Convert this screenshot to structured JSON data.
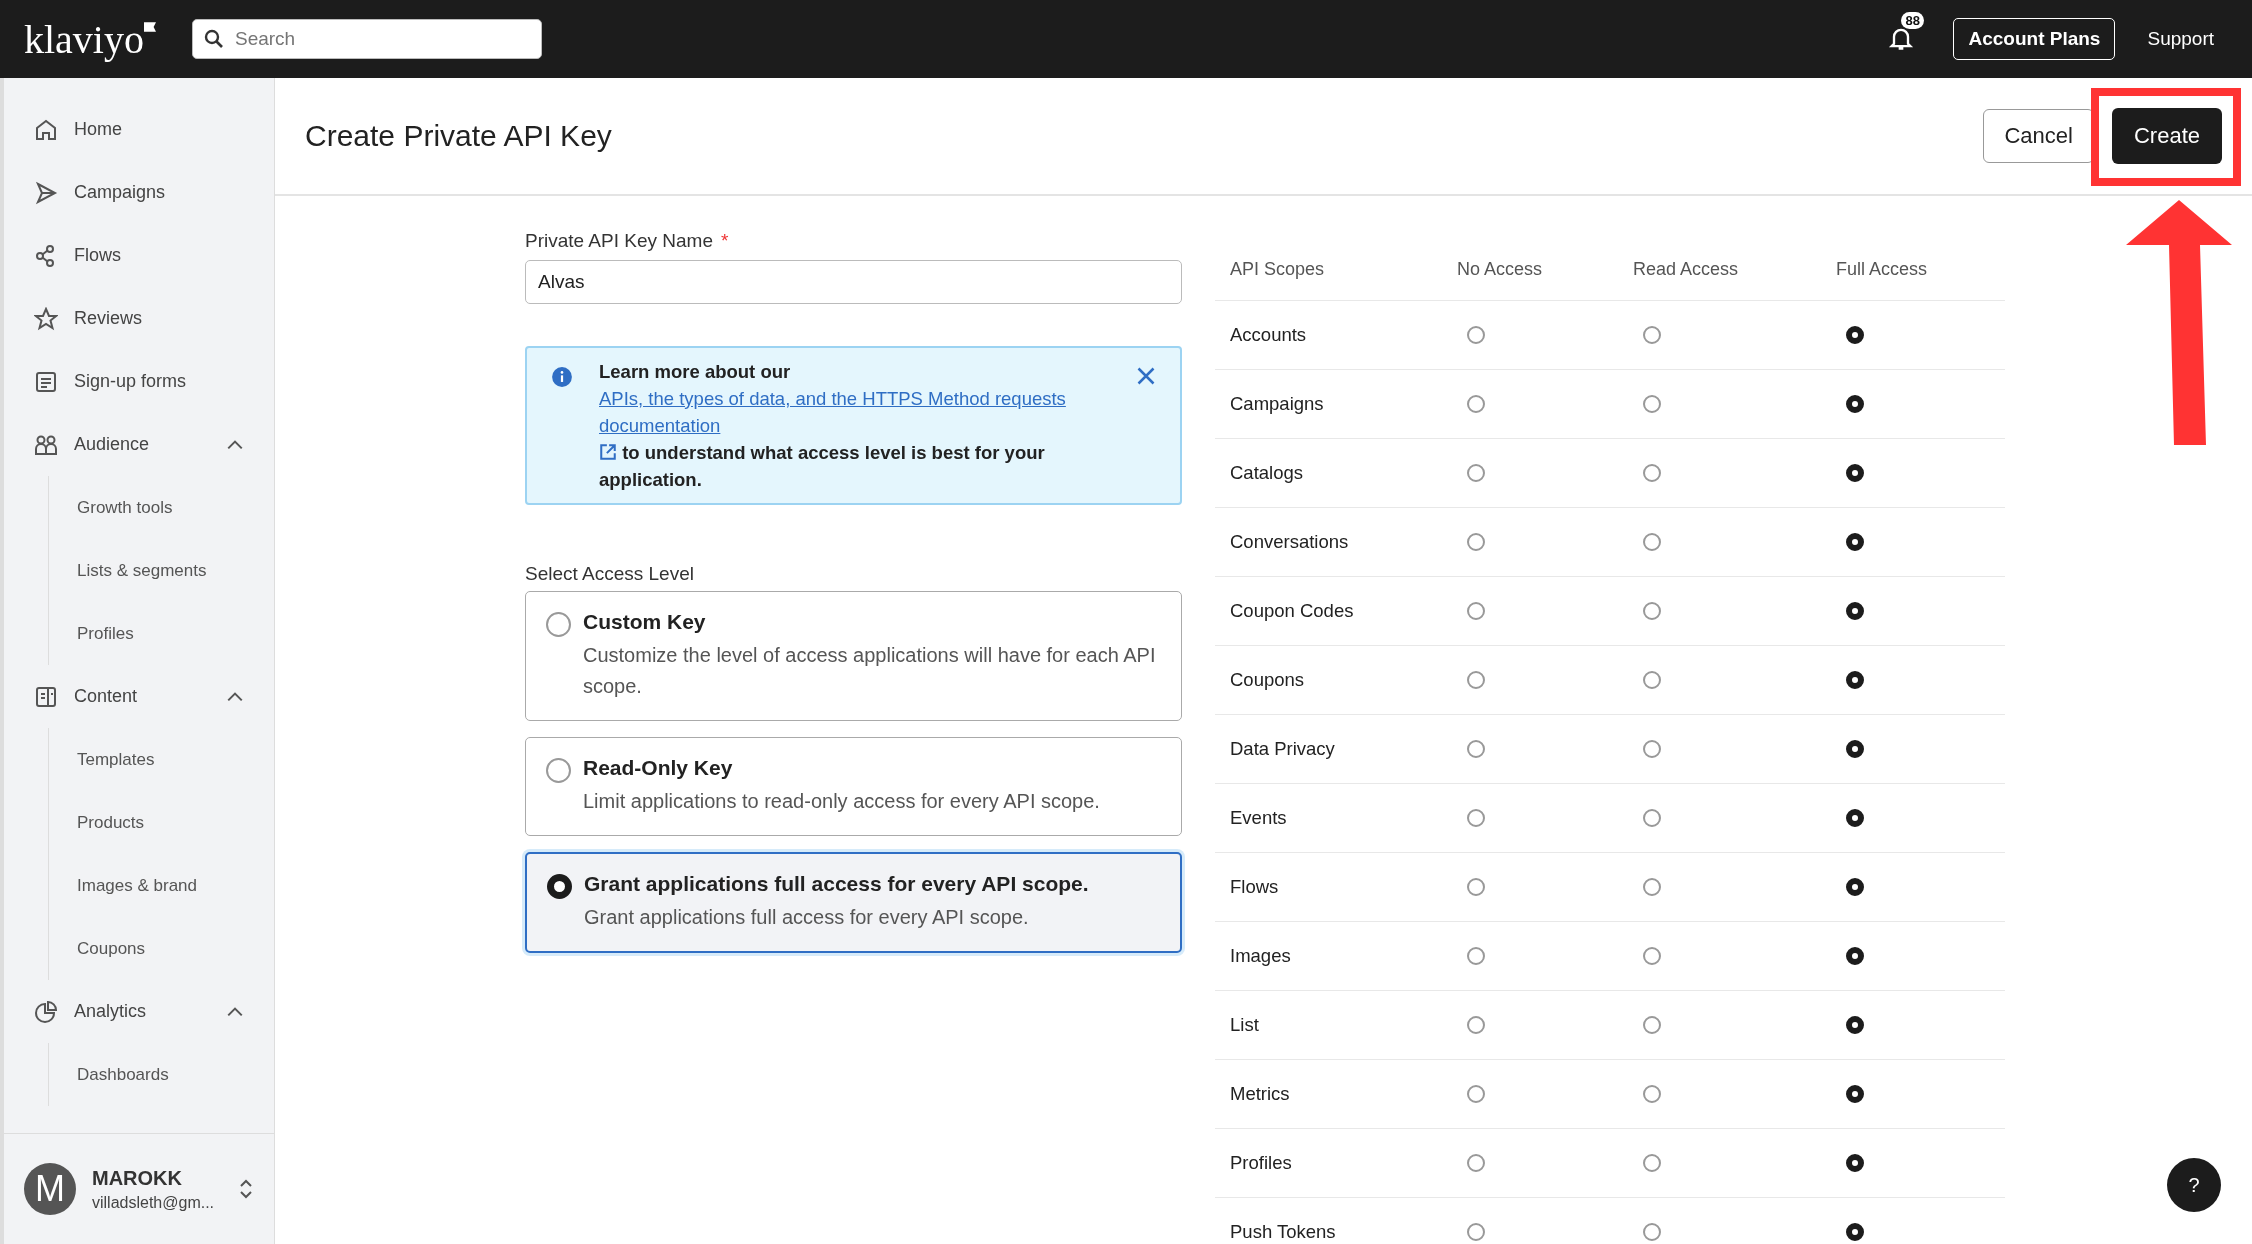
{
  "topbar": {
    "logo": "klaviyo",
    "search": {
      "placeholder": "Search"
    },
    "notification_count": "88",
    "buttons": [
      "Account Plans",
      "Support"
    ]
  },
  "sidebar": {
    "items": [
      {
        "label": "Home"
      },
      {
        "label": "Campaigns"
      },
      {
        "label": "Flows"
      },
      {
        "label": "Reviews"
      },
      {
        "label": "Sign-up forms"
      },
      {
        "label": "Audience",
        "expanded": true,
        "children": [
          {
            "label": "Growth tools"
          },
          {
            "label": "Lists & segments"
          },
          {
            "label": "Profiles"
          }
        ]
      },
      {
        "label": "Content",
        "expanded": true,
        "children": [
          {
            "label": "Templates"
          },
          {
            "label": "Products"
          },
          {
            "label": "Images & brand"
          },
          {
            "label": "Coupons"
          }
        ]
      },
      {
        "label": "Analytics",
        "expanded": true,
        "children": [
          {
            "label": "Dashboards"
          }
        ]
      }
    ],
    "account": {
      "initial": "M",
      "name": "MAROKK",
      "email": "villadsleth@gm..."
    }
  },
  "header": {
    "title": "Create Private API Key",
    "cancel": "Cancel",
    "create": "Create"
  },
  "form": {
    "name_label": "Private API Key Name",
    "required_mark": "*",
    "name_value": "Alvas",
    "notice": {
      "before": "Learn more about our ",
      "link": "APIs, the types of data, and the HTTPS Method requests documentation",
      "after": " to understand what access level is best for your application."
    },
    "access_label": "Select Access Level",
    "access_options": [
      {
        "title": "Custom Key",
        "description": "Customize the level of access applications will have for each API scope.",
        "selected": false
      },
      {
        "title": "Read-Only Key",
        "description": "Limit applications to read-only access for every API scope.",
        "selected": false
      },
      {
        "title": "Grant applications full access for every API scope.",
        "description": "Grant applications full access for every API scope.",
        "selected": true
      }
    ]
  },
  "scopes": {
    "columns": [
      "API Scopes",
      "No Access",
      "Read Access",
      "Full Access"
    ],
    "rows": [
      {
        "name": "Accounts",
        "levels": [
          {
            "selected": false
          },
          {
            "selected": false
          },
          {
            "selected": true
          }
        ]
      },
      {
        "name": "Campaigns",
        "levels": [
          {
            "selected": false
          },
          {
            "selected": false
          },
          {
            "selected": true
          }
        ]
      },
      {
        "name": "Catalogs",
        "levels": [
          {
            "selected": false
          },
          {
            "selected": false
          },
          {
            "selected": true
          }
        ]
      },
      {
        "name": "Conversations",
        "levels": [
          {
            "selected": false
          },
          {
            "selected": false
          },
          {
            "selected": true
          }
        ]
      },
      {
        "name": "Coupon Codes",
        "levels": [
          {
            "selected": false
          },
          {
            "selected": false
          },
          {
            "selected": true
          }
        ]
      },
      {
        "name": "Coupons",
        "levels": [
          {
            "selected": false
          },
          {
            "selected": false
          },
          {
            "selected": true
          }
        ]
      },
      {
        "name": "Data Privacy",
        "levels": [
          {
            "selected": false
          },
          {
            "selected": false
          },
          {
            "selected": true
          }
        ]
      },
      {
        "name": "Events",
        "levels": [
          {
            "selected": false
          },
          {
            "selected": false
          },
          {
            "selected": true
          }
        ]
      },
      {
        "name": "Flows",
        "levels": [
          {
            "selected": false
          },
          {
            "selected": false
          },
          {
            "selected": true
          }
        ]
      },
      {
        "name": "Images",
        "levels": [
          {
            "selected": false
          },
          {
            "selected": false
          },
          {
            "selected": true
          }
        ]
      },
      {
        "name": "List",
        "levels": [
          {
            "selected": false
          },
          {
            "selected": false
          },
          {
            "selected": true
          }
        ]
      },
      {
        "name": "Metrics",
        "levels": [
          {
            "selected": false
          },
          {
            "selected": false
          },
          {
            "selected": true
          }
        ]
      },
      {
        "name": "Profiles",
        "levels": [
          {
            "selected": false
          },
          {
            "selected": false
          },
          {
            "selected": true
          }
        ]
      },
      {
        "name": "Push Tokens",
        "levels": [
          {
            "selected": false
          },
          {
            "selected": false
          },
          {
            "selected": true
          }
        ]
      }
    ]
  },
  "help_button": "?"
}
